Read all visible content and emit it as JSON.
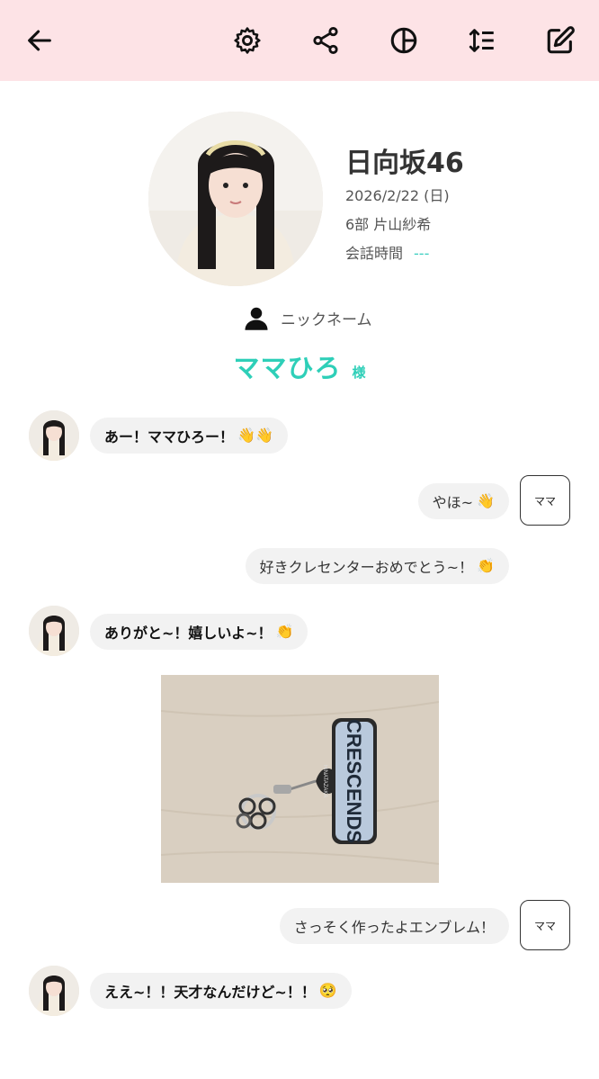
{
  "toolbar": {
    "back": "back-icon",
    "settings": "gear-icon",
    "share": "share-icon",
    "theme": "contrast-icon",
    "sort": "sort-icon",
    "edit": "edit-icon",
    "background": "#fde3e6"
  },
  "profile": {
    "group": "日向坂46",
    "date": "2026/2/22 (日)",
    "member": "6部 片山紗希",
    "talk_time_label": "会話時間",
    "talk_time_value": "---",
    "nickname_label": "ニックネーム",
    "nickname": "ママひろ",
    "honorific": "様",
    "accent": "#2ecfb8"
  },
  "messages": [
    {
      "side": "left",
      "text": "あー！ママひろー！",
      "emoji": "👋👋"
    },
    {
      "side": "right",
      "text": "やほ~",
      "emoji": "👋",
      "badge": "ママ"
    },
    {
      "side": "right",
      "text": "好きクレセンターおめでとう~！",
      "emoji": "👏"
    },
    {
      "side": "left",
      "text": "ありがと~！嬉しいよ~！",
      "emoji": "👏"
    },
    {
      "side": "right",
      "text": "さっそく作ったよエンブレム！",
      "badge": "ママ"
    },
    {
      "side": "left",
      "text": "ええ~！！天才なんだけど~！！",
      "emoji": "🥺"
    }
  ],
  "photo": {
    "tag_top": "HINATAZAKA",
    "tag_main": "CRESCENDS"
  }
}
